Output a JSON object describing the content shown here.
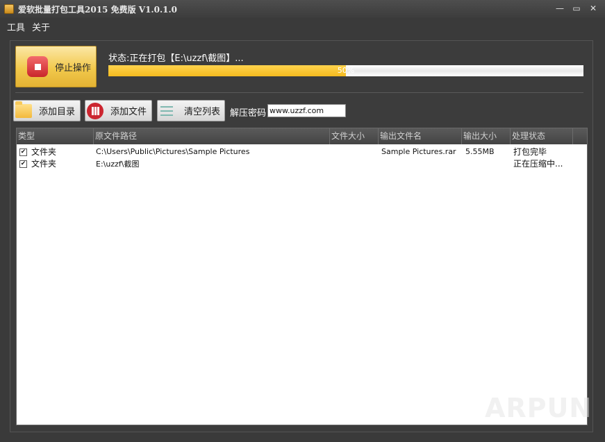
{
  "window": {
    "title": "爱软批量打包工具2015 免费版 V1.0.1.0",
    "minimize": "—",
    "maximize": "▭",
    "close": "✕"
  },
  "menu": {
    "items": [
      "工具",
      "关于"
    ]
  },
  "stop_button": {
    "label": "停止操作"
  },
  "status": {
    "text": "状态:正在打包【E:\\uzzf\\截图】...",
    "progress_percent": 50,
    "progress_label": "50%"
  },
  "toolbar": {
    "add_dir": "添加目录",
    "add_file": "添加文件",
    "clear_list": "清空列表",
    "password_label": "解压密码",
    "password_value": "www.uzzf.com"
  },
  "table": {
    "columns": [
      "类型",
      "原文件路径",
      "文件大小",
      "输出文件名",
      "输出大小",
      "处理状态"
    ],
    "rows": [
      {
        "checked": true,
        "type": "文件夹",
        "path": "C:\\Users\\Public\\Pictures\\Sample Pictures",
        "size": "",
        "output_name": "Sample Pictures.rar",
        "output_size": "5.55MB",
        "status": "打包完毕"
      },
      {
        "checked": true,
        "type": "文件夹",
        "path": "E:\\uzzf\\截图",
        "size": "",
        "output_name": "",
        "output_size": "",
        "status": "正在压缩中..."
      }
    ]
  },
  "watermark": "ARPUN"
}
